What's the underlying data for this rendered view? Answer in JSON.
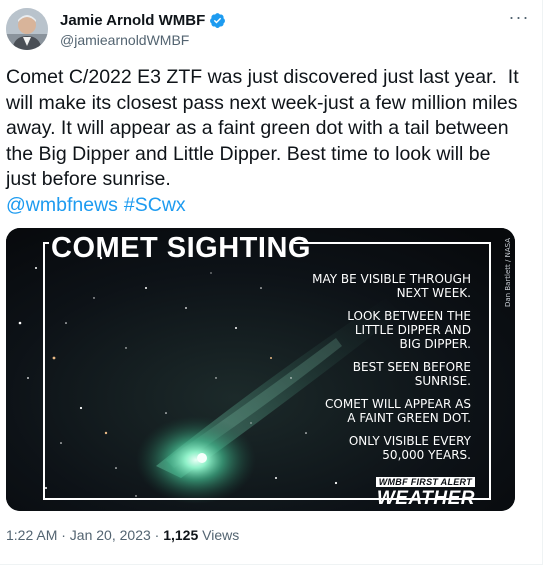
{
  "author": {
    "display_name": "Jamie Arnold WMBF",
    "handle": "@jamiearnoldWMBF",
    "verified": true
  },
  "tweet": {
    "text": "Comet C/2022 E3 ZTF was just discovered just last year.  It will make its closest pass next week-just a few million miles away. It will appear as a faint green dot with a tail between the Big Dipper and Little Dipper. Best time to look will be just before sunrise.",
    "links": [
      "@wmbfnews",
      "#SCwx"
    ]
  },
  "media": {
    "title": "COMET SIGHTING",
    "lines": [
      "MAY BE VISIBLE THROUGH\nNEXT WEEK.",
      "LOOK BETWEEN THE\nLITTLE DIPPER AND\nBIG DIPPER.",
      "BEST SEEN BEFORE\nSUNRISE.",
      "COMET WILL APPEAR AS\nA FAINT GREEN DOT.",
      "ONLY VISIBLE EVERY\n50,000 YEARS."
    ],
    "credit": "Dan Bartlett / NASA",
    "brand_top": "WMBF FIRST ALERT",
    "brand_main": "WEATHER"
  },
  "meta": {
    "time_date": "1:22 AM · Jan 20, 2023 · ",
    "views_count": "1,125",
    "views_label": " Views"
  },
  "colors": {
    "link": "#1d9bf0",
    "verified": "#1d9bf0",
    "text": "#0f1419",
    "secondary": "#536471",
    "comet_glow": "#6fd6b0"
  }
}
